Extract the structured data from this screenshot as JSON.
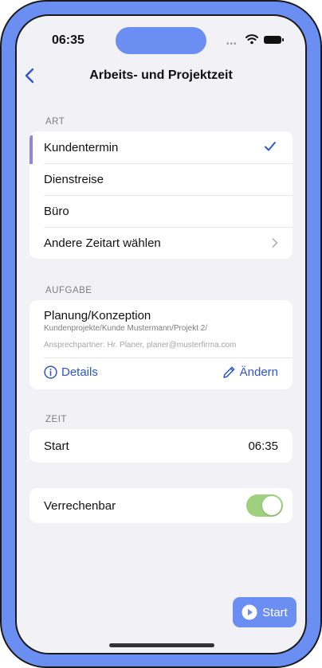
{
  "status": {
    "time": "06:35",
    "dots": "•••"
  },
  "nav": {
    "title": "Arbeits- und Projektzeit"
  },
  "art": {
    "label": "ART",
    "items": [
      {
        "label": "Kundentermin"
      },
      {
        "label": "Dienstreise"
      },
      {
        "label": "Büro"
      },
      {
        "label": "Andere Zeitart wählen"
      }
    ]
  },
  "aufgabe": {
    "label": "AUFGABE",
    "title": "Planung/Konzeption",
    "path": "Kundenprojekte/Kunde Mustermann/Projekt 2/",
    "contact": "Ansprechpartner: Hr. Planer, planer@musterfirma.com",
    "details_label": "Details",
    "edit_label": "Ändern"
  },
  "zeit": {
    "label": "ZEIT",
    "start_label": "Start",
    "start_value": "06:35"
  },
  "billing": {
    "label": "Verrechenbar",
    "enabled": true
  },
  "start_button": {
    "label": "Start"
  },
  "colors": {
    "accent": "#2f57c6",
    "frame": "#6b8ef2",
    "toggle_on": "#9fd07e",
    "selection_bar": "#8e87d6"
  }
}
